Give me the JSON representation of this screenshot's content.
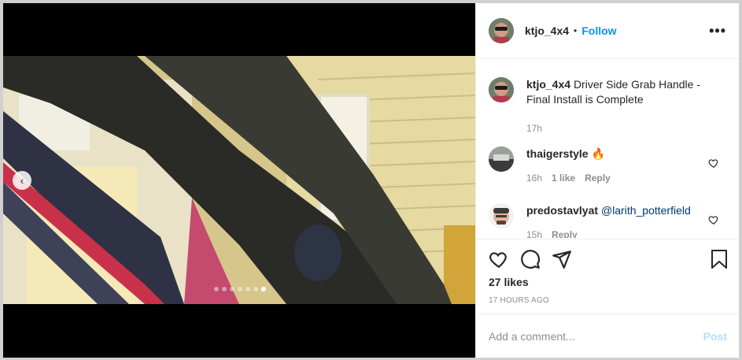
{
  "post": {
    "username": "ktjo_4x4",
    "separator": "•",
    "follow_label": "Follow",
    "more_label": "•••"
  },
  "caption": {
    "username": "ktjo_4x4",
    "text": "Driver Side Grab Handle - Final Install is Complete",
    "time": "17h"
  },
  "comments": [
    {
      "username": "thaigerstyle",
      "text": "🔥",
      "time": "16h",
      "likes": "1 like",
      "reply": "Reply"
    },
    {
      "username": "predostavlyat",
      "text": "@larith_potterfield",
      "time": "15h",
      "reply": "Reply"
    }
  ],
  "actions": {
    "likes": "27 likes",
    "timestamp": "17 HOURS AGO"
  },
  "add_comment": {
    "placeholder": "Add a comment...",
    "post_label": "Post"
  },
  "carousel": {
    "count": 7,
    "active_index": 6,
    "prev_label": "‹"
  },
  "colors": {
    "link": "#0095f6",
    "post_disabled": "#b2dffc",
    "mention": "#00376b",
    "muted": "#8e8e8e"
  },
  "icons": [
    "chevron-left-icon",
    "heart-icon",
    "comment-icon",
    "share-icon",
    "bookmark-icon",
    "more-icon"
  ]
}
